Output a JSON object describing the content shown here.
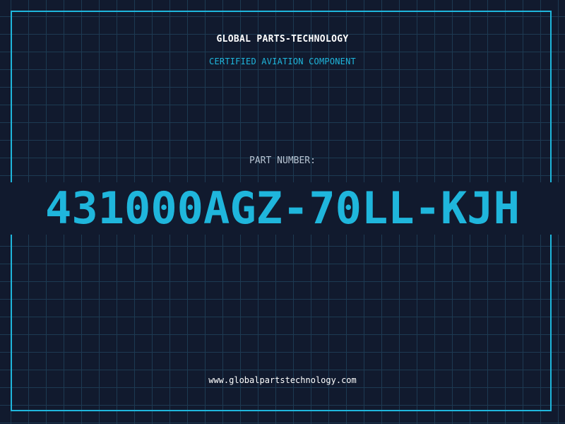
{
  "label": {
    "company": "GLOBAL PARTS-TECHNOLOGY",
    "subtitle": "CERTIFIED AVIATION COMPONENT",
    "part_label": "PART NUMBER:",
    "part_number": "431000AGZ-70LL-KJH",
    "website": "www.globalpartstechnology.com"
  },
  "colors": {
    "background": "#111a2e",
    "grid": "#1d3a52",
    "accent": "#1fb6dc",
    "text_primary": "#ffffff",
    "text_muted": "#b8c4d2"
  }
}
